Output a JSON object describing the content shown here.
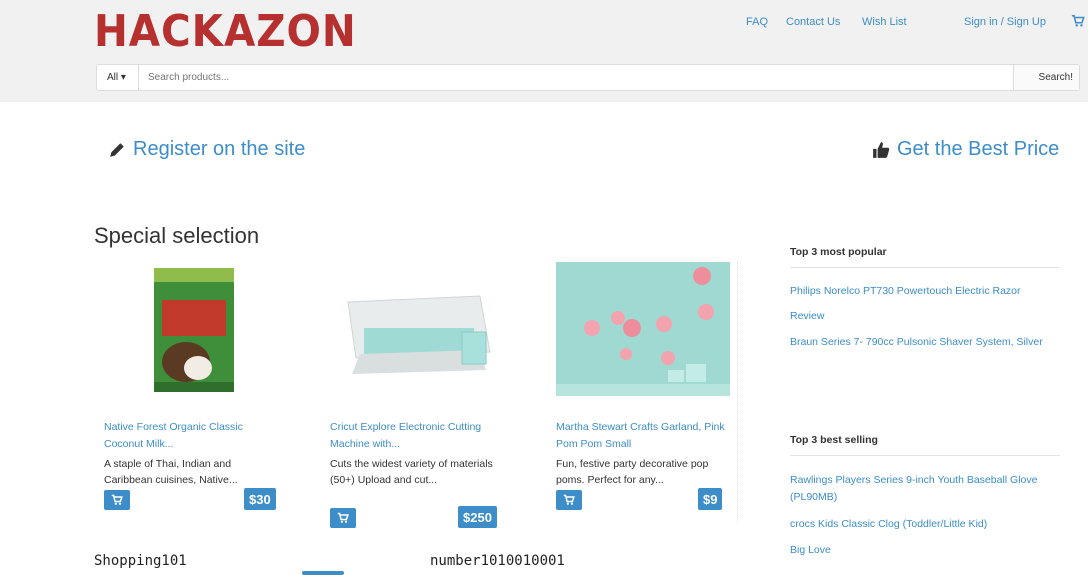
{
  "header": {
    "logo": "HACKAZON",
    "nav": [
      "FAQ",
      "Contact Us",
      "Wish List",
      "Sign in / Sign Up"
    ],
    "search": {
      "category": "All ▾",
      "placeholder": "Search products...",
      "button": "Search!"
    },
    "icons": {
      "cart": "cart-icon"
    }
  },
  "cta": {
    "register": "Register on the site",
    "best_price": "Get the Best Price",
    "icons": {
      "register": "pencil-icon",
      "best_price": "thumbs-up-icon"
    }
  },
  "main": {
    "section_title": "Special selection",
    "products": [
      {
        "name": "Native Forest Organic Classic Coconut Milk...",
        "desc": "A staple of Thai, Indian and Caribbean cuisines, Native...",
        "price": "$30"
      },
      {
        "name": "Cricut Explore Electronic Cutting Machine with...",
        "desc": "Cuts the widest variety of materials (50+) Upload and cut...",
        "price": "$250"
      },
      {
        "name": "Martha Stewart Crafts Garland, Pink Pom Pom Small",
        "desc": "Fun, festive party decorative pop poms. Perfect for any...",
        "price": "$9"
      }
    ]
  },
  "sidebar": {
    "popular_title": "Top 3 most popular",
    "popular": [
      "Philips Norelco PT730 Powertouch Electric Razor",
      "Review",
      "Braun Series 7- 790cc Pulsonic Shaver System, Silver"
    ],
    "best_title": "Top 3 best selling",
    "best": [
      "Rawlings Players Series 9-inch Youth Baseball Glove (PL90MB)",
      "crocs Kids Classic Clog (Toddler/Little Kid)",
      "Big Love"
    ]
  },
  "footer": {
    "left": "Shopping101",
    "right": "number1010010001"
  },
  "colors": {
    "accent": "#3c8dc8",
    "logo": "#b5302f",
    "header_bg": "#f1f1f1"
  }
}
